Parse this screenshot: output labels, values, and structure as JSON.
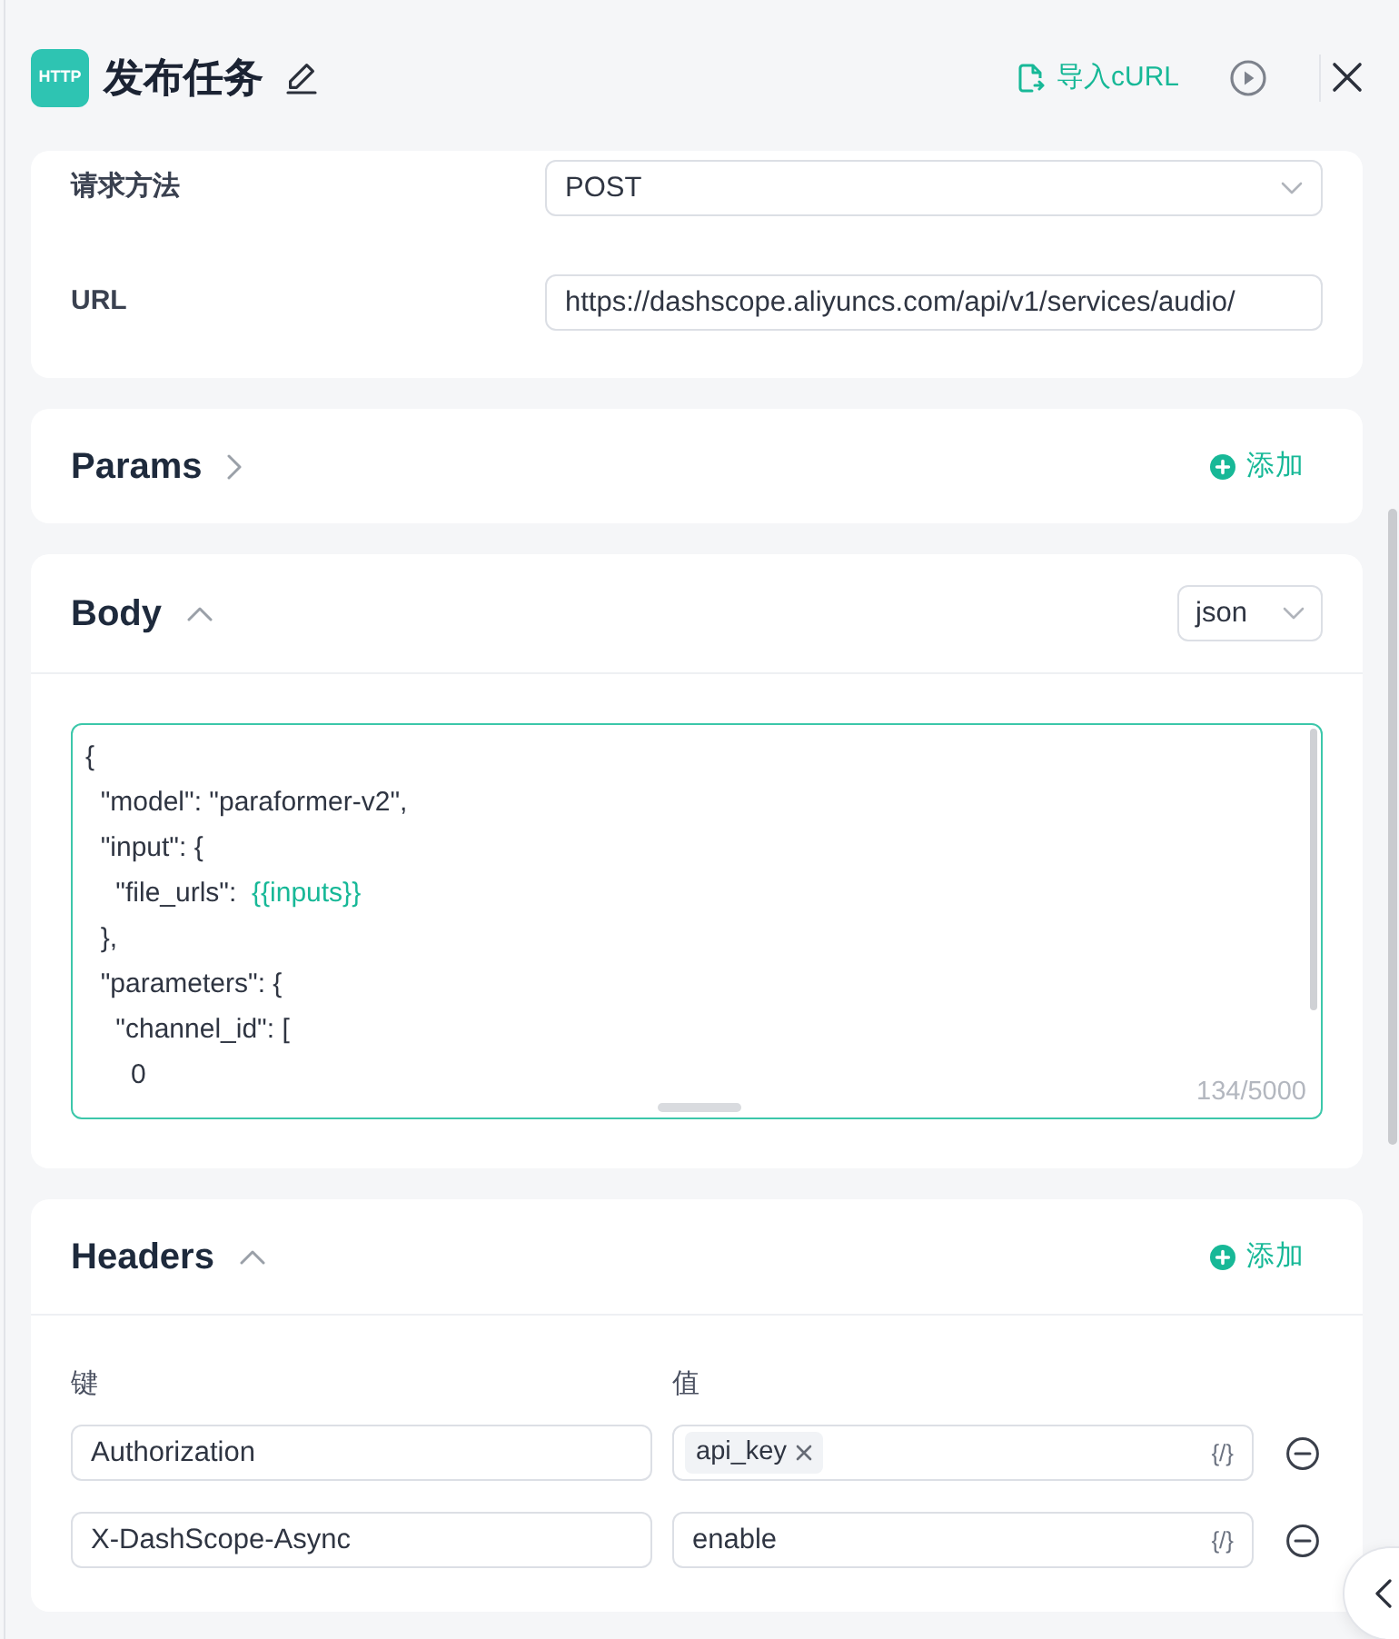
{
  "header": {
    "logo": "HTTP",
    "title": "发布任务",
    "import_label": "导入cURL"
  },
  "request": {
    "fields": [
      {
        "kind": "select",
        "label": "请求方法",
        "value": "POST"
      },
      {
        "kind": "input",
        "label": "URL",
        "value": "https://dashscope.aliyuncs.com/api/v1/services/audio/"
      }
    ]
  },
  "sections": [
    {
      "kind": "params",
      "title": "Params",
      "expanded": false,
      "add_label": "添加"
    },
    {
      "kind": "body",
      "title": "Body",
      "expanded": true,
      "format": "json",
      "editor": {
        "focused": true,
        "lines": [
          {
            "text": "{"
          },
          {
            "text": "  \"model\": \"paraformer-v2\","
          },
          {
            "text": "  \"input\": {"
          },
          {
            "text": "    \"file_urls\":  ",
            "variable": "{{inputs}}"
          },
          {
            "text": "  },"
          },
          {
            "text": "  \"parameters\": {"
          },
          {
            "text": "    \"channel_id\": ["
          },
          {
            "text": "      0"
          }
        ],
        "count": "134/5000"
      }
    },
    {
      "kind": "headers",
      "title": "Headers",
      "expanded": true,
      "add_label": "添加",
      "columns": [
        "键",
        "值"
      ],
      "rows": [
        {
          "key": "Authorization",
          "value": {
            "kind": "tag",
            "text": "api_key"
          },
          "variable_button": "{/}"
        },
        {
          "key": "X-DashScope-Async",
          "value": {
            "kind": "text",
            "text": "enable"
          },
          "variable_button": "{/}"
        }
      ]
    }
  ]
}
